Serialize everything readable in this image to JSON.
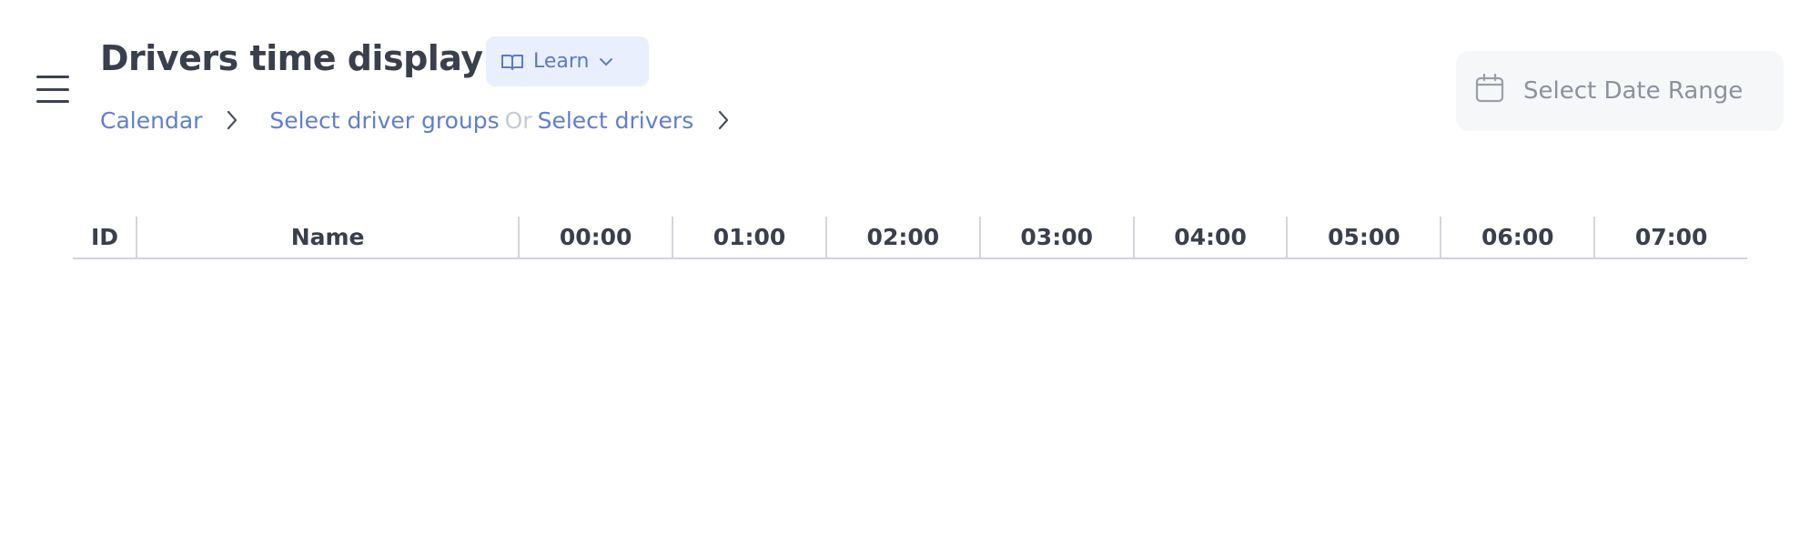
{
  "header": {
    "title": "Drivers time display",
    "learn_label": "Learn"
  },
  "breadcrumb": {
    "calendar": "Calendar",
    "driver_groups": "Select driver groups",
    "or": "Or",
    "drivers": "Select drivers"
  },
  "date_range": {
    "placeholder": "Select Date Range"
  },
  "table": {
    "columns": [
      "ID",
      "Name",
      "00:00",
      "01:00",
      "02:00",
      "03:00",
      "04:00",
      "05:00",
      "06:00",
      "07:00"
    ]
  },
  "icons": {
    "menu": "hamburger-menu-icon",
    "learn": "book-icon",
    "learn_chevron": "chevron-down-icon",
    "breadcrumb_sep": "chevron-right-icon",
    "date": "calendar-icon"
  },
  "colors": {
    "link": "#5f7fcc",
    "learn_bg": "#e9effc",
    "title": "#3a3f4c",
    "muted": "#8c919c"
  }
}
